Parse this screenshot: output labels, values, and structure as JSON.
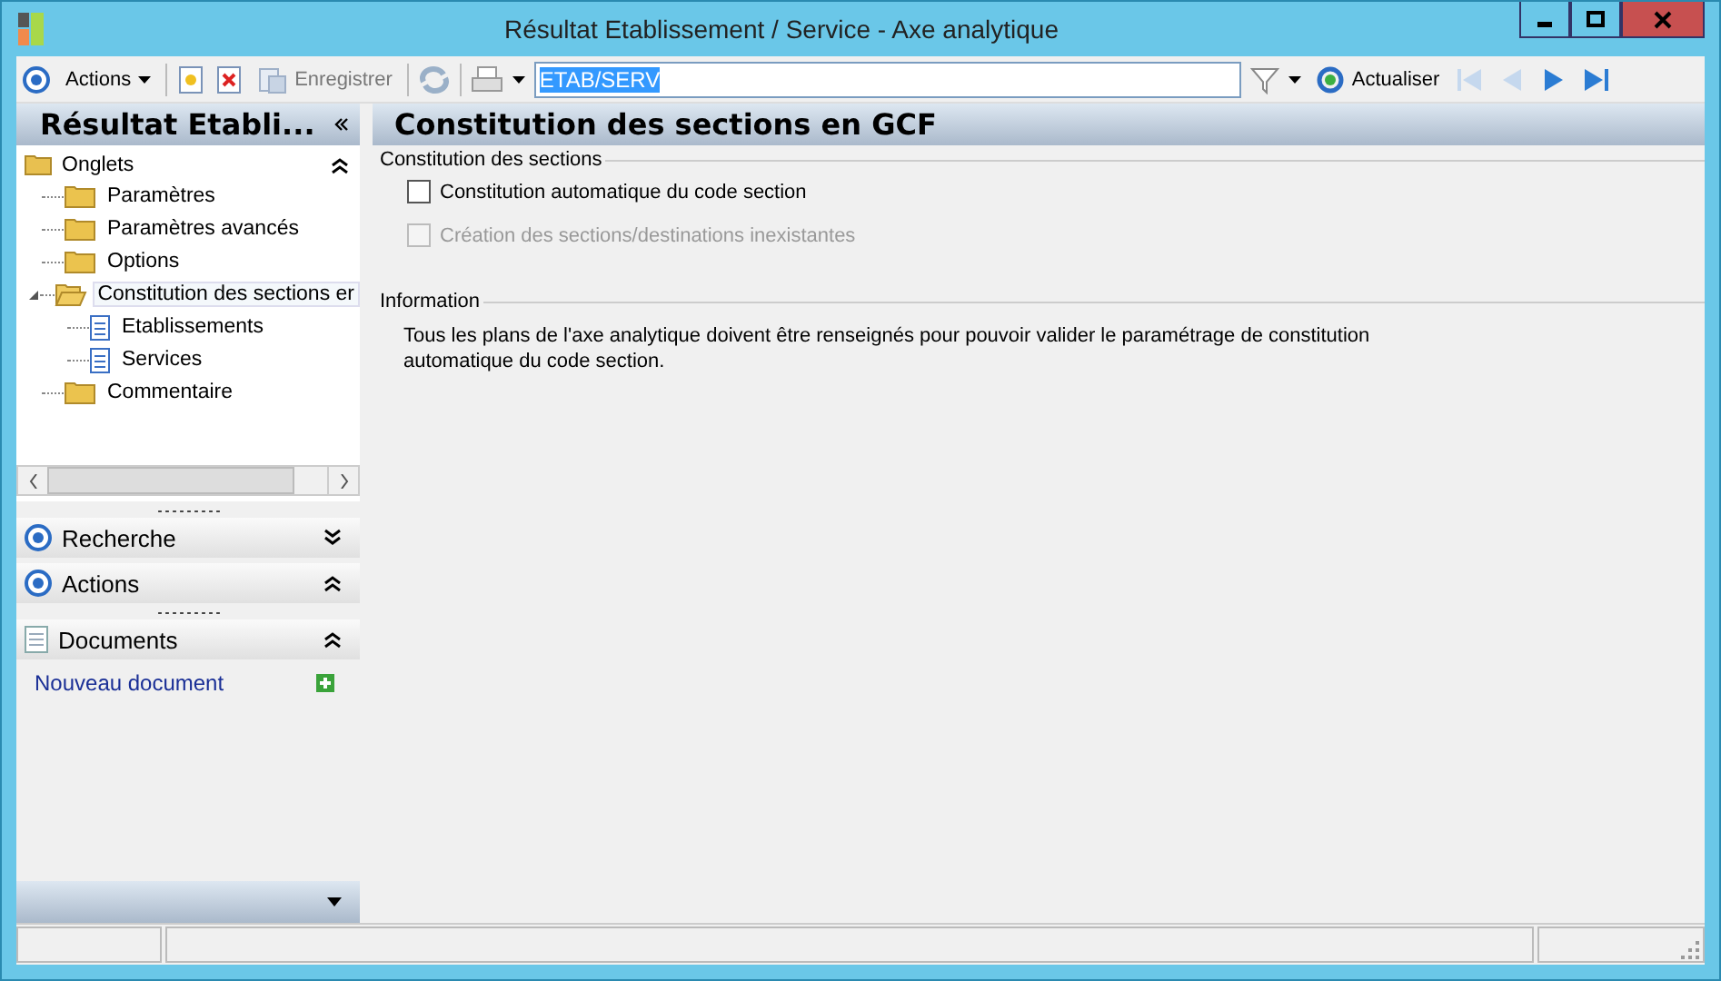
{
  "window": {
    "title": "Résultat Etablissement / Service -  Axe analytique"
  },
  "toolbar": {
    "actions_label": "Actions",
    "save_label": "Enregistrer",
    "save_disabled": true,
    "refresh_label": "Actualiser",
    "search": {
      "value": "ETAB/SERV",
      "selected": true
    },
    "nav": [
      {
        "kind": "first",
        "disabled": true
      },
      {
        "kind": "prev",
        "disabled": true
      },
      {
        "kind": "next",
        "disabled": false
      },
      {
        "kind": "last",
        "disabled": false
      }
    ]
  },
  "sidebar": {
    "title": "Résultat Etabli...",
    "tree": {
      "label": "Onglets",
      "expanded": true,
      "items": [
        {
          "label": "Paramètres",
          "kind": "folder",
          "selected": false
        },
        {
          "label": "Paramètres avancés",
          "kind": "folder",
          "selected": false
        },
        {
          "label": "Options",
          "kind": "folder",
          "selected": false
        },
        {
          "label": "Constitution des sections er",
          "kind": "folder",
          "selected": true,
          "expanded": true,
          "children": [
            {
              "label": "Etablissements",
              "kind": "document",
              "selected": false
            },
            {
              "label": "Services",
              "kind": "document",
              "selected": false
            }
          ]
        },
        {
          "label": "Commentaire",
          "kind": "folder",
          "selected": false
        }
      ]
    },
    "sections": [
      {
        "label": "Recherche",
        "kind": "radio",
        "expanded": false
      },
      {
        "label": "Actions",
        "kind": "radio",
        "expanded": true
      },
      {
        "label": "Documents",
        "kind": "document",
        "expanded": true,
        "link": "Nouveau document"
      }
    ]
  },
  "main": {
    "title": "Constitution des sections en GCF",
    "groups": [
      {
        "legend": "Constitution des sections",
        "kind": "checks",
        "options": [
          {
            "label": "Constitution automatique du code section",
            "checked": false,
            "disabled": false
          },
          {
            "label": "Création des sections/destinations inexistantes",
            "checked": false,
            "disabled": true
          }
        ]
      },
      {
        "legend": "Information",
        "kind": "text",
        "text": "Tous les plans de l'axe analytique doivent être renseignés pour pouvoir valider le paramétrage de constitution automatique du code section."
      }
    ]
  }
}
